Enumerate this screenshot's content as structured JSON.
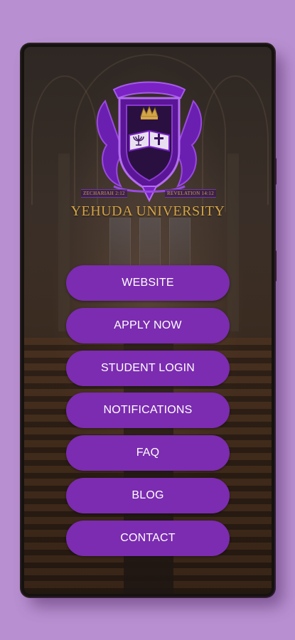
{
  "app": {
    "title": "YEHUDA UNIVERSITY",
    "motto_left": "ZECHARIAH 2:12",
    "motto_right": "REVELATION 14:12"
  },
  "menu": {
    "items": [
      {
        "label": "WEBSITE"
      },
      {
        "label": "APPLY NOW"
      },
      {
        "label": "STUDENT LOGIN"
      },
      {
        "label": "NOTIFICATIONS"
      },
      {
        "label": "FAQ"
      },
      {
        "label": "BLOG"
      },
      {
        "label": "CONTACT"
      }
    ]
  },
  "colors": {
    "page_background": "#b890d1",
    "button": "#7b2cb0",
    "button_text": "#ffffff",
    "title_gold": "#d4a548",
    "crest_purple": "#7a22c4"
  },
  "icons": [
    "crown-icon",
    "menorah-icon",
    "cross-icon",
    "crest-shield-icon"
  ]
}
